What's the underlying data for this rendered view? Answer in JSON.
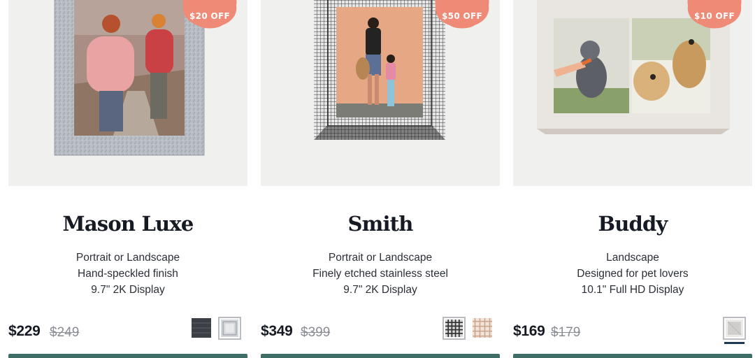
{
  "products": [
    {
      "name": "Mason Luxe",
      "features": [
        "Portrait or Landscape",
        "Hand-speckled finish",
        "9.7\" 2K Display"
      ],
      "price": "$229",
      "compare_price": "$249",
      "badge": "$20 OFF",
      "swatches": [
        "graphite",
        "sea-salt"
      ],
      "selected_swatch": "sea-salt",
      "image_alt": "Mason Luxe frame photo"
    },
    {
      "name": "Smith",
      "features": [
        "Portrait or Landscape",
        "Finely etched stainless steel",
        "9.7\" 2K Display"
      ],
      "price": "$349",
      "compare_price": "$399",
      "badge": "$50 OFF",
      "swatches": [
        "steel-mesh",
        "brass-mesh"
      ],
      "selected_swatch": "steel-mesh",
      "image_alt": "Smith frame photo"
    },
    {
      "name": "Buddy",
      "features": [
        "Landscape",
        "Designed for pet lovers",
        "10.1\" Full HD Display"
      ],
      "price": "$169",
      "compare_price": "$179",
      "badge": "$10 OFF",
      "swatches": [
        "white"
      ],
      "selected_swatch": "white",
      "image_alt": "Buddy frame photo"
    }
  ],
  "colors": {
    "badge": "#ee8a76",
    "cta": "#3f6e66",
    "image_background": "#f0f0ef",
    "text": "#151a23",
    "compare_text": "#8a8d93"
  }
}
